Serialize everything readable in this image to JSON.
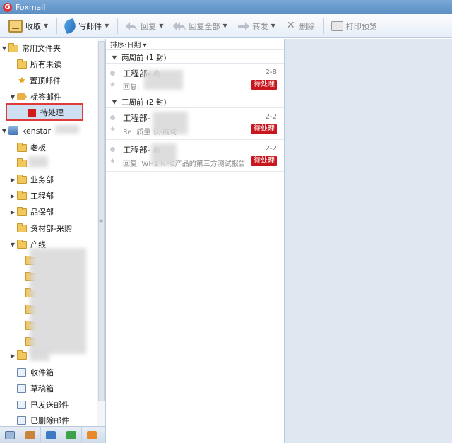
{
  "app": {
    "title": "Foxmail",
    "logo": "G"
  },
  "toolbar": {
    "receive": "收取",
    "compose": "写邮件",
    "reply": "回复",
    "reply_all": "回复全部",
    "forward": "转发",
    "delete": "删除",
    "print_preview": "打印预览"
  },
  "sidebar": {
    "common_folders": "常用文件夹",
    "all_unread": "所有未读",
    "pinned": "置顶邮件",
    "tagged": "标签邮件",
    "pending_tag": "待处理",
    "account": "kenstar",
    "boss": "老板",
    "business": "业务部",
    "engineering": "工程部",
    "quality": "品保部",
    "procurement": "资材部-采购",
    "production": "产线",
    "inbox": "收件箱",
    "drafts": "草稿箱",
    "sent": "已发送邮件",
    "deleted": "已删除邮件"
  },
  "msglist": {
    "sort_label": "排序:日期 ▾",
    "groups": [
      {
        "label": "两周前 (1 封)"
      },
      {
        "label": "三周前 (2 封)"
      }
    ],
    "messages": [
      {
        "sender": "工程部-",
        "date": "2-8",
        "subject": "回复: ",
        "badge": "待处理"
      },
      {
        "sender": "工程部-",
        "date": "2-2",
        "subject": "Re: 质量          认-展试",
        "badge": "待处理"
      },
      {
        "sender": "工程部-",
        "date": "2-2",
        "subject": "回复: WH1  NFC产品的第三方测试报告",
        "badge": "待处理"
      }
    ]
  },
  "colors": {
    "badge": "#c8161d",
    "selection_outline": "#e03b3b",
    "titlebar": "#5b8fc5"
  }
}
